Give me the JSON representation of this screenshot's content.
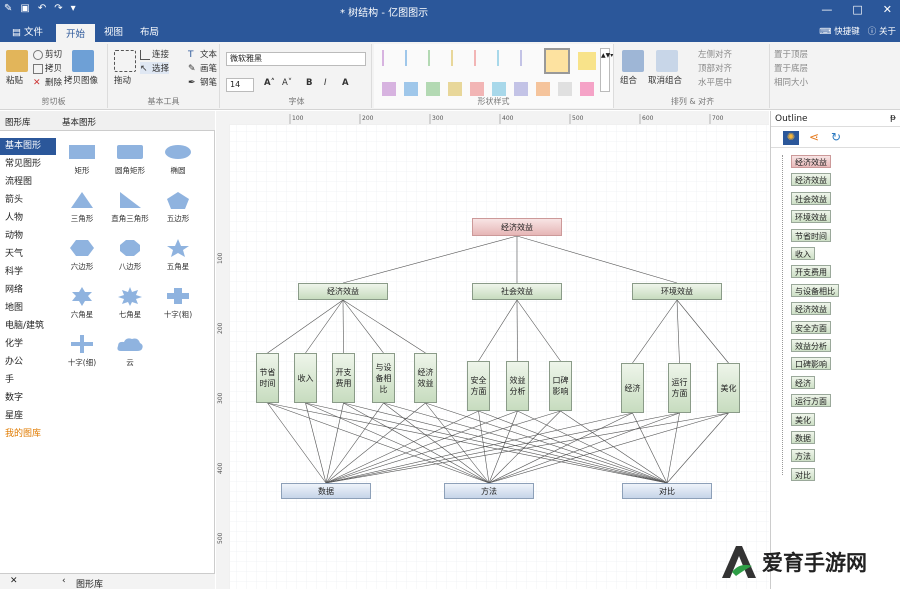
{
  "titlebar": {
    "title": "* 树结构 - 亿图图示",
    "qa_icons": [
      "app-icon",
      "save-icon",
      "undo-icon",
      "redo-icon",
      "dropdown-icon"
    ],
    "controls": [
      "—",
      "□",
      "✕"
    ]
  },
  "tabs": [
    {
      "label": "文件",
      "active": false
    },
    {
      "label": "开始",
      "active": true
    },
    {
      "label": "视图",
      "active": false
    },
    {
      "label": "布局",
      "active": false
    }
  ],
  "tabs_right": {
    "feedback": "快捷键",
    "help": "关于"
  },
  "ribbon": {
    "clipboard": {
      "label": "剪切板",
      "paste": "粘贴",
      "cut": "剪切",
      "copy": "拷贝",
      "delete": "删除",
      "paste_image": "拷贝图像"
    },
    "tools": {
      "label": "基本工具",
      "move": "拖动",
      "connect": "连接",
      "select": "选择",
      "text": "文本",
      "pen": "画笔",
      "draw": "钢笔"
    },
    "font": {
      "label": "字体",
      "family": "微软雅黑",
      "size": "14",
      "bold": "B",
      "italic": "I",
      "underline": "U",
      "color": "A"
    },
    "styles": {
      "label": "形状样式",
      "colors": [
        "#d7b3e0",
        "#9fc7ea",
        "#b3d9b3",
        "#e8d79a",
        "#f2b5b5",
        "#a8d8ea",
        "#c3c3e6",
        "#f5c49c",
        "#e0e0e0",
        "#f5a3c7",
        "#b9e0a5"
      ],
      "selected_color": "#fde2a0",
      "outline_color": "#f8e38a"
    },
    "arrange": {
      "label": "排列 & 对齐",
      "group": "组合",
      "ungroup": "取消组合",
      "align_left": "左侧对齐",
      "align_top": "顶部对齐",
      "align_center": "水平居中",
      "bring_front": "置于顶层",
      "bring_back": "置于底层",
      "same_size": "相同大小"
    }
  },
  "left_panel": {
    "header_tabs": [
      "图形库",
      "基本图形"
    ],
    "categories": [
      "基本图形",
      "常见图形",
      "流程图",
      "箭头",
      "人物",
      "动物",
      "天气",
      "科学",
      "网络",
      "地图",
      "电脑/建筑",
      "化学",
      "办公",
      "手",
      "数字",
      "星座",
      "我的图库"
    ],
    "shapes": [
      {
        "label": "矩形",
        "kind": "rect"
      },
      {
        "label": "圆角矩形",
        "kind": "roundrect"
      },
      {
        "label": "椭圆",
        "kind": "ellipse"
      },
      {
        "label": "三角形",
        "kind": "triangle"
      },
      {
        "label": "直角三角形",
        "kind": "righttri"
      },
      {
        "label": "五边形",
        "kind": "pentagon"
      },
      {
        "label": "六边形",
        "kind": "hexagon"
      },
      {
        "label": "八边形",
        "kind": "octagon"
      },
      {
        "label": "五角星",
        "kind": "star5"
      },
      {
        "label": "六角星",
        "kind": "star6"
      },
      {
        "label": "七角星",
        "kind": "star7"
      },
      {
        "label": "十字(粗)",
        "kind": "crossthick"
      },
      {
        "label": "十字(细)",
        "kind": "crossthin"
      },
      {
        "label": "云",
        "kind": "cloud"
      }
    ],
    "footer_close": "✕",
    "footer_label": "图形库"
  },
  "ruler": {
    "h": [
      "100",
      "200",
      "300",
      "400",
      "500",
      "600",
      "700"
    ],
    "v": [
      "100",
      "200",
      "300",
      "400",
      "500"
    ]
  },
  "diagram": {
    "root": "经济效益",
    "level1": [
      "经济效益",
      "社会效益",
      "环境效益"
    ],
    "level2": [
      [
        "节省时间",
        "收入",
        "开支费用",
        "与设备相比",
        "经济效益"
      ],
      [
        "安全方面",
        "效益分析",
        "口碑影响"
      ],
      [
        "经济",
        "运行方面",
        "美化"
      ]
    ],
    "level3": [
      "数据",
      "方法",
      "对比"
    ]
  },
  "outline": {
    "title": "Outline",
    "pin": "ᵽ",
    "items": [
      "经济效益",
      "经济效益",
      "社会效益",
      "环境效益",
      "节省时间",
      "收入",
      "开支费用",
      "与设备相比",
      "经济效益",
      "安全方面",
      "效益分析",
      "口碑影响",
      "经济",
      "运行方面",
      "美化",
      "数据",
      "方法",
      "对比"
    ]
  },
  "watermark": {
    "text": "爱育手游网"
  }
}
